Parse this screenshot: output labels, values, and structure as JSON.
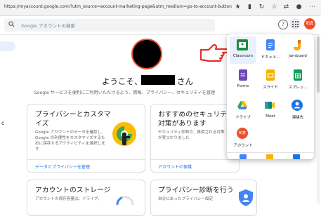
{
  "browser": {
    "url": "https://myaccount.google.com/?utm_source=account-marketing-page&utm_medium=go-to-account-button",
    "icons": [
      "star-icon",
      "bookmark-icon",
      "history-icon",
      "extension-icon",
      "menu-icon",
      "profile-icon",
      "more-icon"
    ]
  },
  "header": {
    "search_placeholder": "Google アカウントの検索",
    "help_label": "?",
    "avatar_label": "和真"
  },
  "sidebar": {
    "edge_letter": "c"
  },
  "welcome": {
    "prefix": "ようこそ、",
    "suffix": "さん",
    "subtitle": "Google サービスを便利にご利用いただけるよう、情報、プライバシー、セキュリティを管理"
  },
  "cards": [
    {
      "title": "プライバシーとカスタマイズ",
      "body": "Google アカウントのデータを確認し、Google の利便性をカスタマイズするために保存するアクティビティを選択します",
      "link": "データとプライバシーを管理"
    },
    {
      "title": "おすすめのセキュリティ対策があります",
      "body": "セキュリティ診断で、推奨される対策が見つかりました",
      "link": "アカウントの保護"
    },
    {
      "title": "アカウントのストレージ",
      "body": "アカウントの保存容量は、ドライブ、"
    },
    {
      "title": "プライバシー診断を行う",
      "body": "自分にあったプライバシー設定"
    }
  ],
  "apps": [
    {
      "label": "Classroom",
      "color": "#1e8e3e",
      "icon": "classroom-icon"
    },
    {
      "label": "ドキュメ...",
      "color": "#4285f4",
      "icon": "docs-icon"
    },
    {
      "label": "Jamboard",
      "color": "#f9ab00",
      "icon": "jamboard-icon"
    },
    {
      "label": "Forms",
      "color": "#7248b9",
      "icon": "forms-icon"
    },
    {
      "label": "スライド",
      "color": "#f4b400",
      "icon": "slides-icon"
    },
    {
      "label": "スプレッ...",
      "color": "#0f9d58",
      "icon": "sheets-icon"
    },
    {
      "label": "ドライブ",
      "color": "#34a853",
      "icon": "drive-icon"
    },
    {
      "label": "Meet",
      "color": "#00897b",
      "icon": "meet-icon"
    },
    {
      "label": "連絡先",
      "color": "#1a73e8",
      "icon": "contacts-icon"
    },
    {
      "label": "アカウント",
      "color": "#e8502c",
      "icon": "account-icon",
      "avatar_text": "和真"
    }
  ],
  "colors": {
    "accent": "#1a73e8",
    "avatar": "#e8502c",
    "hand_outline": "#e0312a"
  }
}
